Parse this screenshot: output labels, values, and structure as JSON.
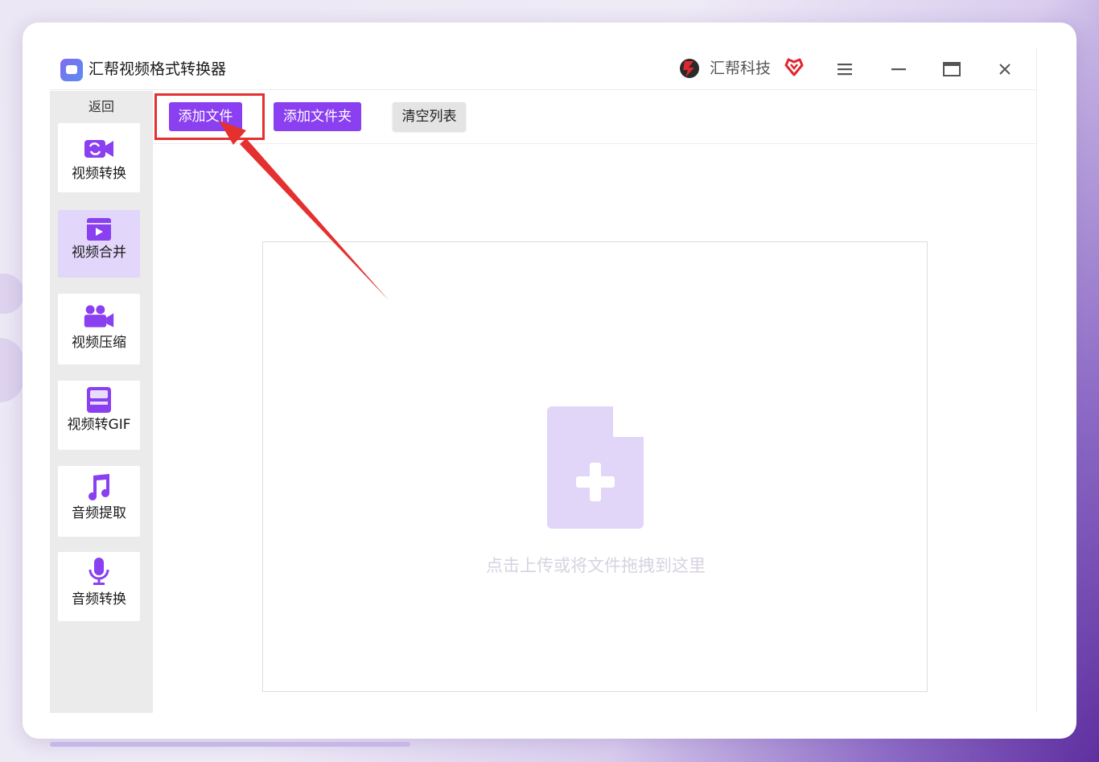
{
  "window": {
    "title": "汇帮视频格式转换器",
    "brand": "汇帮科技"
  },
  "sidebar": {
    "back_label": "返回",
    "items": [
      {
        "label": "视频转换",
        "icon": "video-convert-icon",
        "active": false
      },
      {
        "label": "视频合并",
        "icon": "video-merge-icon",
        "active": true
      },
      {
        "label": "视频压缩",
        "icon": "video-compress-icon",
        "active": false
      },
      {
        "label": "视频转GIF",
        "icon": "video-gif-icon",
        "active": false
      },
      {
        "label": "音频提取",
        "icon": "music-note-icon",
        "active": false
      },
      {
        "label": "音频转换",
        "icon": "microphone-icon",
        "active": false
      }
    ]
  },
  "toolbar": {
    "add_file": "添加文件",
    "add_folder": "添加文件夹",
    "clear_list": "清空列表"
  },
  "dropzone": {
    "hint": "点击上传或将文件拖拽到这里",
    "icon": "file-add-icon"
  },
  "colors": {
    "accent": "#8a3ff0",
    "active_nav": "#e3d6fb",
    "annotation": "#e53030",
    "file_icon": "#e1d5f8"
  }
}
